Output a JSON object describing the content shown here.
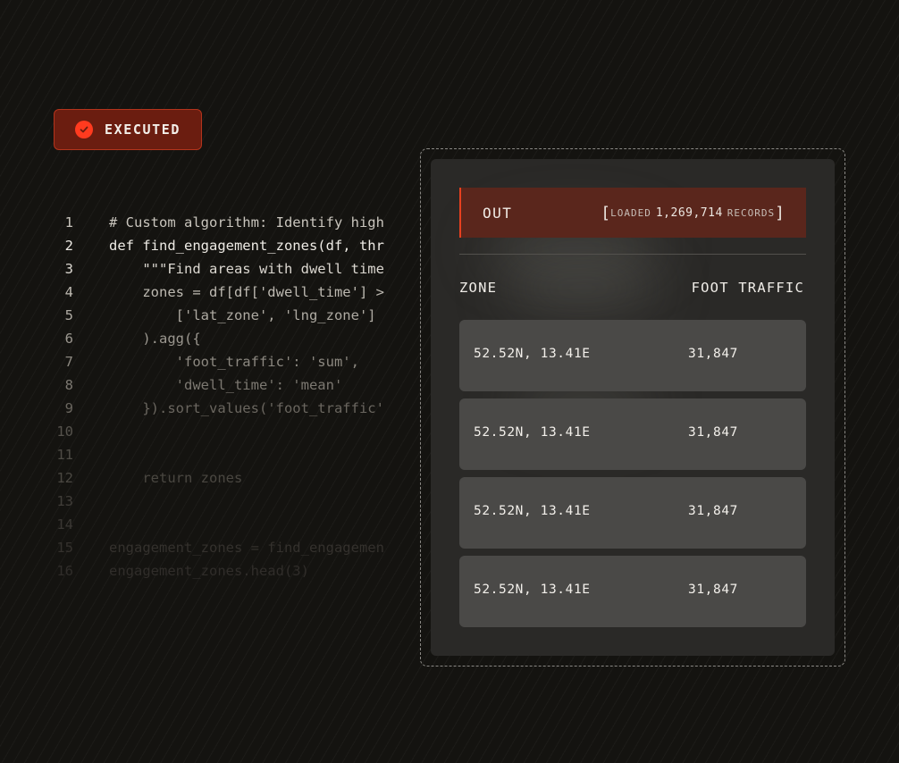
{
  "badge": {
    "label": "EXECUTED",
    "icon": "check-circle-icon",
    "color": "#ff3b1f"
  },
  "code": {
    "lines": [
      {
        "n": "1",
        "text": "# Custom algorithm: Identify high"
      },
      {
        "n": "2",
        "text": "def find_engagement_zones(df, thr"
      },
      {
        "n": "3",
        "text": "    \"\"\"Find areas with dwell time"
      },
      {
        "n": "4",
        "text": "    zones = df[df['dwell_time'] >"
      },
      {
        "n": "5",
        "text": "        ['lat_zone', 'lng_zone']"
      },
      {
        "n": "6",
        "text": "    ).agg({"
      },
      {
        "n": "7",
        "text": "        'foot_traffic': 'sum',"
      },
      {
        "n": "8",
        "text": "        'dwell_time': 'mean'"
      },
      {
        "n": "9",
        "text": "    }).sort_values('foot_traffic'"
      },
      {
        "n": "10",
        "text": ""
      },
      {
        "n": "11",
        "text": ""
      },
      {
        "n": "12",
        "text": "    return zones"
      },
      {
        "n": "13",
        "text": ""
      },
      {
        "n": "14",
        "text": ""
      },
      {
        "n": "15",
        "text": "engagement_zones = find_engagemen"
      },
      {
        "n": "16",
        "text": "engagement_zones.head(3)"
      }
    ]
  },
  "output": {
    "out_label": "OUT",
    "status_prefix": "LOADED",
    "status_count": "1,269,714",
    "status_suffix": "RECORDS",
    "accent": "#e8401f",
    "headers": {
      "zone": "ZONE",
      "traffic": "FOOT TRAFFIC"
    },
    "rows": [
      {
        "zone": "52.52N, 13.41E",
        "traffic": "31,847"
      },
      {
        "zone": "52.52N, 13.41E",
        "traffic": "31,847"
      },
      {
        "zone": "52.52N, 13.41E",
        "traffic": "31,847"
      },
      {
        "zone": "52.52N, 13.41E",
        "traffic": "31,847"
      }
    ]
  }
}
